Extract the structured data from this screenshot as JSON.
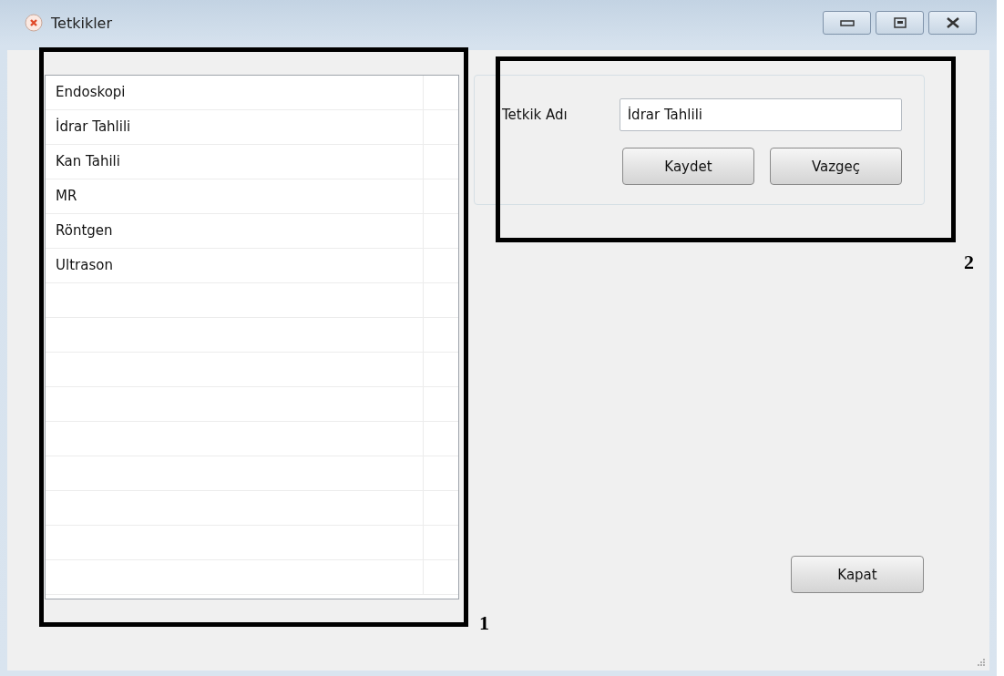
{
  "window": {
    "title": "Tetkikler"
  },
  "list": {
    "items": [
      "Endoskopi",
      "İdrar Tahlili",
      "Kan Tahili",
      "MR",
      "Röntgen",
      "Ultrason"
    ]
  },
  "form": {
    "label": "Tetkik Adı",
    "value": "İdrar Tahlili",
    "buttons": [
      "Kaydet",
      "Vazgeç"
    ]
  },
  "close_button": "Kapat",
  "annotations": [
    {
      "label": "1"
    },
    {
      "label": "2"
    }
  ]
}
